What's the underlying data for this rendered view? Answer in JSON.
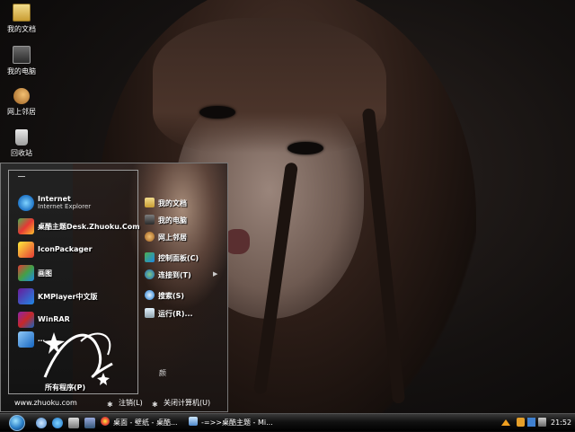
{
  "desktop": {
    "icons": [
      {
        "label": "我的文档",
        "icon": "folder-icon"
      },
      {
        "label": "我的电脑",
        "icon": "computer-icon"
      },
      {
        "label": "网上邻居",
        "icon": "network-icon"
      },
      {
        "label": "回收站",
        "icon": "recycle-bin-icon"
      }
    ]
  },
  "start_menu": {
    "pinned": [
      {
        "title": "Internet",
        "subtitle": "Internet Explorer",
        "icon": "ie-icon"
      },
      {
        "title": "桌酷主题Desk.Zhuoku.Com",
        "icon": "theme-icon"
      },
      {
        "title": "IconPackager",
        "icon": "iconpackager-icon"
      },
      {
        "title": "画图",
        "icon": "paint-icon"
      },
      {
        "title": "KMPlayer中文版",
        "icon": "kmplayer-icon"
      },
      {
        "title": "WinRAR",
        "icon": "winrar-icon"
      },
      {
        "title": "…",
        "icon": "settings-icon"
      }
    ],
    "all_programs": "所有程序(P)",
    "right": [
      {
        "label": "我的文档",
        "icon": "folder-icon"
      },
      {
        "label": "我的电脑",
        "icon": "computer-icon"
      },
      {
        "label": "网上邻居",
        "icon": "network-icon"
      },
      {
        "label": "控制面板(C)",
        "icon": "control-panel-icon"
      },
      {
        "label": "连接到(T)",
        "icon": "connect-icon",
        "submenu": true
      },
      {
        "label": "搜索(S)",
        "icon": "search-icon"
      },
      {
        "label": "运行(R)...",
        "icon": "run-icon"
      }
    ],
    "photo_caption": "颜",
    "site_url": "www.zhuoku.com",
    "logoff_label": "注销(L)",
    "shutdown_label": "关闭计算机(U)"
  },
  "taskbar": {
    "buttons": [
      {
        "label": "桌面 - 壁纸 - 桌酷...",
        "icon": "browser-icon"
      },
      {
        "label": "-=>>桌酷主题 - Mi...",
        "icon": "window-icon"
      }
    ],
    "clock": "21:52"
  }
}
